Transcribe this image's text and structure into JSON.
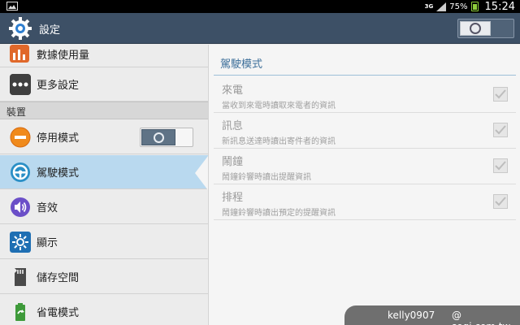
{
  "status_bar": {
    "network": "3G",
    "battery": "75%",
    "time": "15:24"
  },
  "action_bar": {
    "title": "設定",
    "master_switch_on": false
  },
  "left_list": {
    "items_top": [
      {
        "label": "數據使用量",
        "icon": "data-usage-icon"
      },
      {
        "label": "更多設定",
        "icon": "more-settings-icon"
      }
    ],
    "section_header": "裝置",
    "items": [
      {
        "label": "停用模式",
        "icon": "block-mode-icon",
        "switch_on": false
      },
      {
        "label": "駕駛模式",
        "icon": "driving-mode-icon",
        "selected": true
      },
      {
        "label": "音效",
        "icon": "sound-icon"
      },
      {
        "label": "顯示",
        "icon": "display-icon"
      },
      {
        "label": "儲存空間",
        "icon": "storage-icon"
      },
      {
        "label": "省電模式",
        "icon": "power-saving-icon"
      }
    ]
  },
  "detail": {
    "title": "駕駛模式",
    "items": [
      {
        "title": "來電",
        "summary": "當收到來電時讀取來電者的資訊",
        "checked": true,
        "enabled": false
      },
      {
        "title": "訊息",
        "summary": "新訊息送達時讀出寄件者的資訊",
        "checked": true,
        "enabled": false
      },
      {
        "title": "鬧鐘",
        "summary": "鬧鐘鈴響時讀出提醒資訊",
        "checked": true,
        "enabled": false
      },
      {
        "title": "排程",
        "summary": "鬧鐘鈴響時讀出預定的提醒資訊",
        "checked": true,
        "enabled": false
      }
    ]
  },
  "watermark": {
    "user": "kelly0907",
    "site": "@ sogi.com.tw"
  },
  "colors": {
    "action_bar": "#3d5066",
    "selected_row": "#b9d9ef",
    "detail_title": "#3d6f9a"
  }
}
